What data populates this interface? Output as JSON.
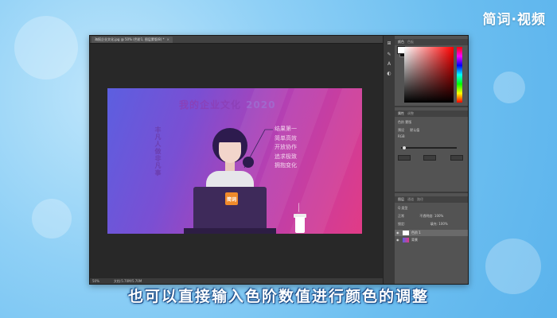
{
  "brand": {
    "text": "简词·视频"
  },
  "document_tab": {
    "name": "海报企业文化.jpg @ 50% (色阶1, 图层蒙版/8) *",
    "close": "×"
  },
  "artwork": {
    "title": "我的企业文化",
    "title_suffix": "2020",
    "vertical_text": "丰凡人做非凡事",
    "callout_lines": [
      "结果第一",
      "简单高效",
      "开放协作",
      "追求极致",
      "拥抱变化"
    ],
    "laptop_logo": "简词"
  },
  "status_bar": {
    "zoom": "50%",
    "doc_size": "文档:5.70M/5.70M"
  },
  "panels": {
    "color_tabs": [
      "颜色",
      "色板"
    ],
    "properties_tabs": [
      "属性",
      "调整"
    ],
    "properties_title": "色阶 蒙版",
    "preset_label": "预设",
    "preset_value": "默认值",
    "channel_value": "RGB",
    "layers_tabs": [
      "图层",
      "通道",
      "路径"
    ],
    "blend_mode": "正常",
    "opacity_label": "不透明度:",
    "opacity_value": "100%",
    "lock_label": "锁定:",
    "fill_label": "填充:",
    "fill_value": "100%",
    "kind_label": "Q 类型",
    "layers": [
      {
        "name": "色阶 1",
        "selected": true
      },
      {
        "name": "背景",
        "selected": false
      }
    ]
  },
  "caption": "也可以直接输入色阶数值进行颜色的调整",
  "colors": {
    "accent": "#e13b86",
    "brand_bg": "#6bbef0"
  }
}
